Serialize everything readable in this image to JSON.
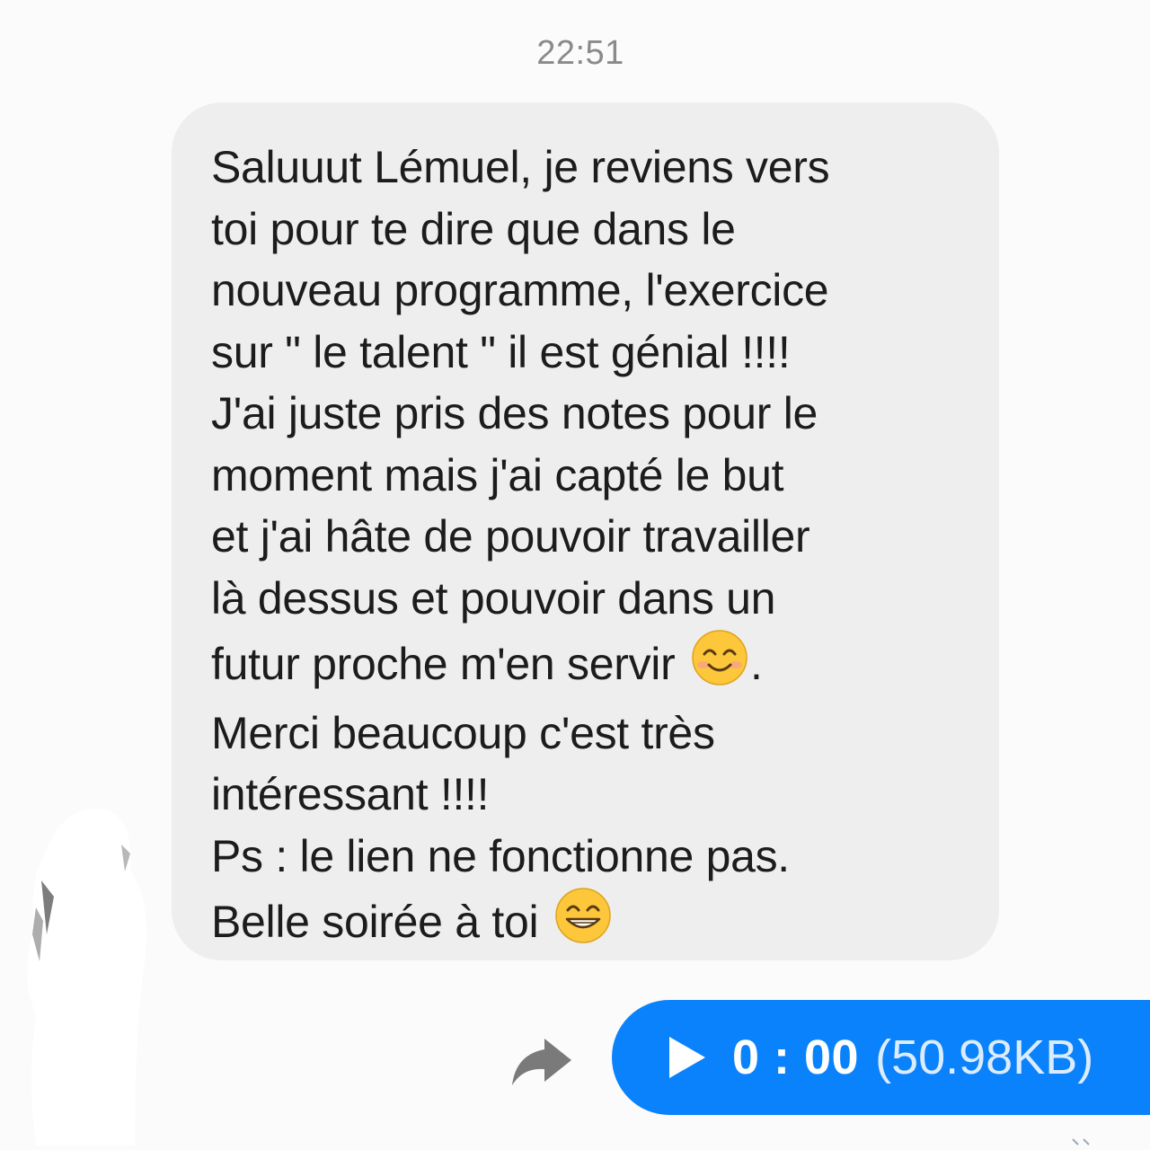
{
  "conversation": {
    "timestamp": "22:51",
    "incoming_message": {
      "lines": [
        "Saluuut Lémuel, je reviens vers",
        "toi pour te dire que dans le",
        "nouveau programme, l'exercice",
        "sur \" le talent \" il est génial !!!!",
        "J'ai juste pris des notes pour le",
        "moment mais j'ai capté le but",
        "et j'ai hâte de pouvoir travailler",
        "là dessus et pouvoir dans un",
        "futur proche m'en servir",
        ".",
        "Merci beaucoup c'est très",
        "intéressant !!!!",
        "Ps : le lien ne fonctionne pas.",
        "Belle soirée à toi"
      ],
      "emojis": [
        "smiling-face-with-smiling-eyes",
        "beaming-face-with-smiling-eyes"
      ]
    },
    "voice_message": {
      "duration": "0 : 00",
      "size": "(50.98KB)"
    }
  },
  "colors": {
    "background": "#fbfbfb",
    "incoming_bubble": "#eeeeee",
    "outgoing_bubble": "#0a82fb",
    "timestamp_text": "#8a8a8a",
    "message_text": "#1c1c1c",
    "emoji_face": "#fcc73a"
  },
  "icons": [
    "forward-icon",
    "play-icon",
    "smiling-emoji-icon",
    "grinning-emoji-icon"
  ]
}
